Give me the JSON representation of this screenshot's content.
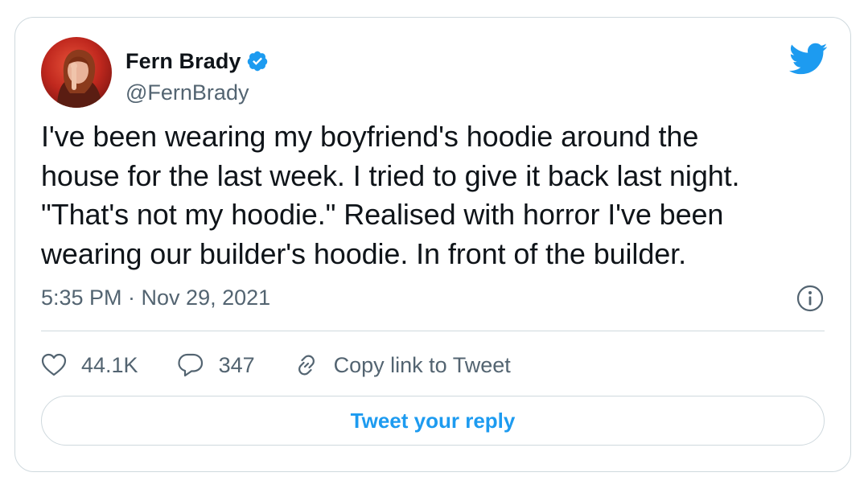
{
  "tweet": {
    "author": {
      "display_name": "Fern Brady",
      "handle": "@FernBrady",
      "verified": true,
      "avatar_icon": "profile-photo"
    },
    "text": "I've been wearing my boyfriend's hoodie around the\nhouse for the last week. I tried to give it back last night.\n\"That's not my hoodie.\" Realised with horror I've been\nwearing our builder's hoodie. In front of the builder.",
    "timestamp": "5:35 PM · Nov 29, 2021",
    "actions": {
      "like_count": "44.1K",
      "reply_count": "347",
      "copy_link_label": "Copy link to Tweet"
    },
    "reply_button_label": "Tweet your reply"
  },
  "icons": {
    "brand": "twitter-bird-icon",
    "verified": "verified-badge-icon",
    "info": "info-icon",
    "like": "heart-icon",
    "reply": "speech-bubble-icon",
    "link": "link-icon"
  },
  "colors": {
    "brand_blue": "#1d9bf0",
    "text_primary": "#0f1419",
    "text_secondary": "#536471",
    "border": "#cfd9de"
  }
}
